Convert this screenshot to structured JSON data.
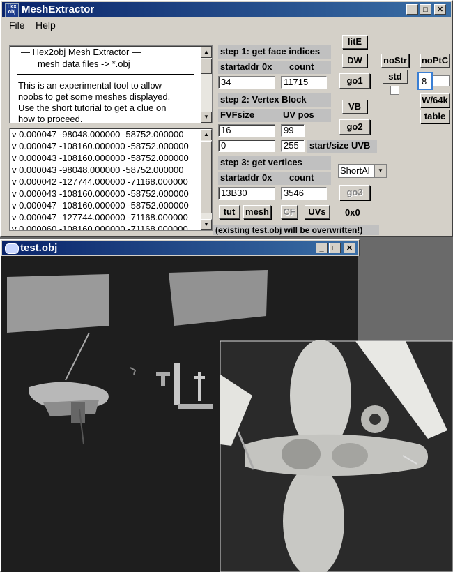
{
  "main_window": {
    "title": "MeshExtractor",
    "icon_text": "Hex obj",
    "menu": [
      "File",
      "Help"
    ],
    "info": {
      "header1": "—   Hex2obj Mesh Extractor   —",
      "header2": "mesh data files -> *.obj",
      "body": [
        "This is an experimental tool to allow",
        "noobs to get some meshes displayed.",
        "Use the short tutorial to get a clue on",
        "how to proceed."
      ]
    },
    "vertices": [
      "v 0.000047 -98048.000000 -58752.000000",
      "v 0.000047 -108160.000000 -58752.000000",
      "v 0.000043 -108160.000000 -58752.000000",
      "v 0.000043 -98048.000000 -58752.000000",
      "v 0.000042 -127744.000000 -71168.000000",
      "v 0.000043 -108160.000000 -58752.000000",
      "v 0.000047 -108160.000000 -58752.000000",
      "v 0.000047 -127744.000000 -71168.000000",
      "v 0.000060 -108160.000000 -71168.000000"
    ],
    "step1": {
      "title": "step 1: get face indices",
      "col1": "startaddr 0x",
      "col2": "count",
      "startaddr": "34",
      "count": "11715"
    },
    "step2": {
      "title": "step 2: Vertex Block",
      "col1": "FVFsize",
      "col2": "UV pos",
      "fvfsize": "16",
      "uvpos": "99",
      "uvstart": "0",
      "uvsize": "255",
      "uv_label": "start/size UVB"
    },
    "step3": {
      "title": "step 3: get vertices",
      "col1": "startaddr 0x",
      "col2": "count",
      "startaddr": "13B30",
      "count": "3546"
    },
    "buttons": {
      "lite": "litE",
      "dw": "DW",
      "go1": "go1",
      "vb": "VB",
      "go2": "go2",
      "go3": "go3",
      "nostr": "noStr",
      "noptc": "noPtC",
      "std": "std",
      "w64": "W/64k",
      "table": "table",
      "tut": "tut",
      "mesh": "mesh",
      "cf": "CF",
      "uvs": "UVs"
    },
    "field_8": "8",
    "shortal": "ShortAl",
    "hex_readout": "0x0",
    "warning": "(existing test.obj will be overwritten!)"
  },
  "viewer_window": {
    "title": "test.obj"
  },
  "colors": {
    "title_start": "#0a246a",
    "title_end": "#3a6ea5",
    "face": "#d4d0c8",
    "viewport": "#1e1e1e"
  }
}
